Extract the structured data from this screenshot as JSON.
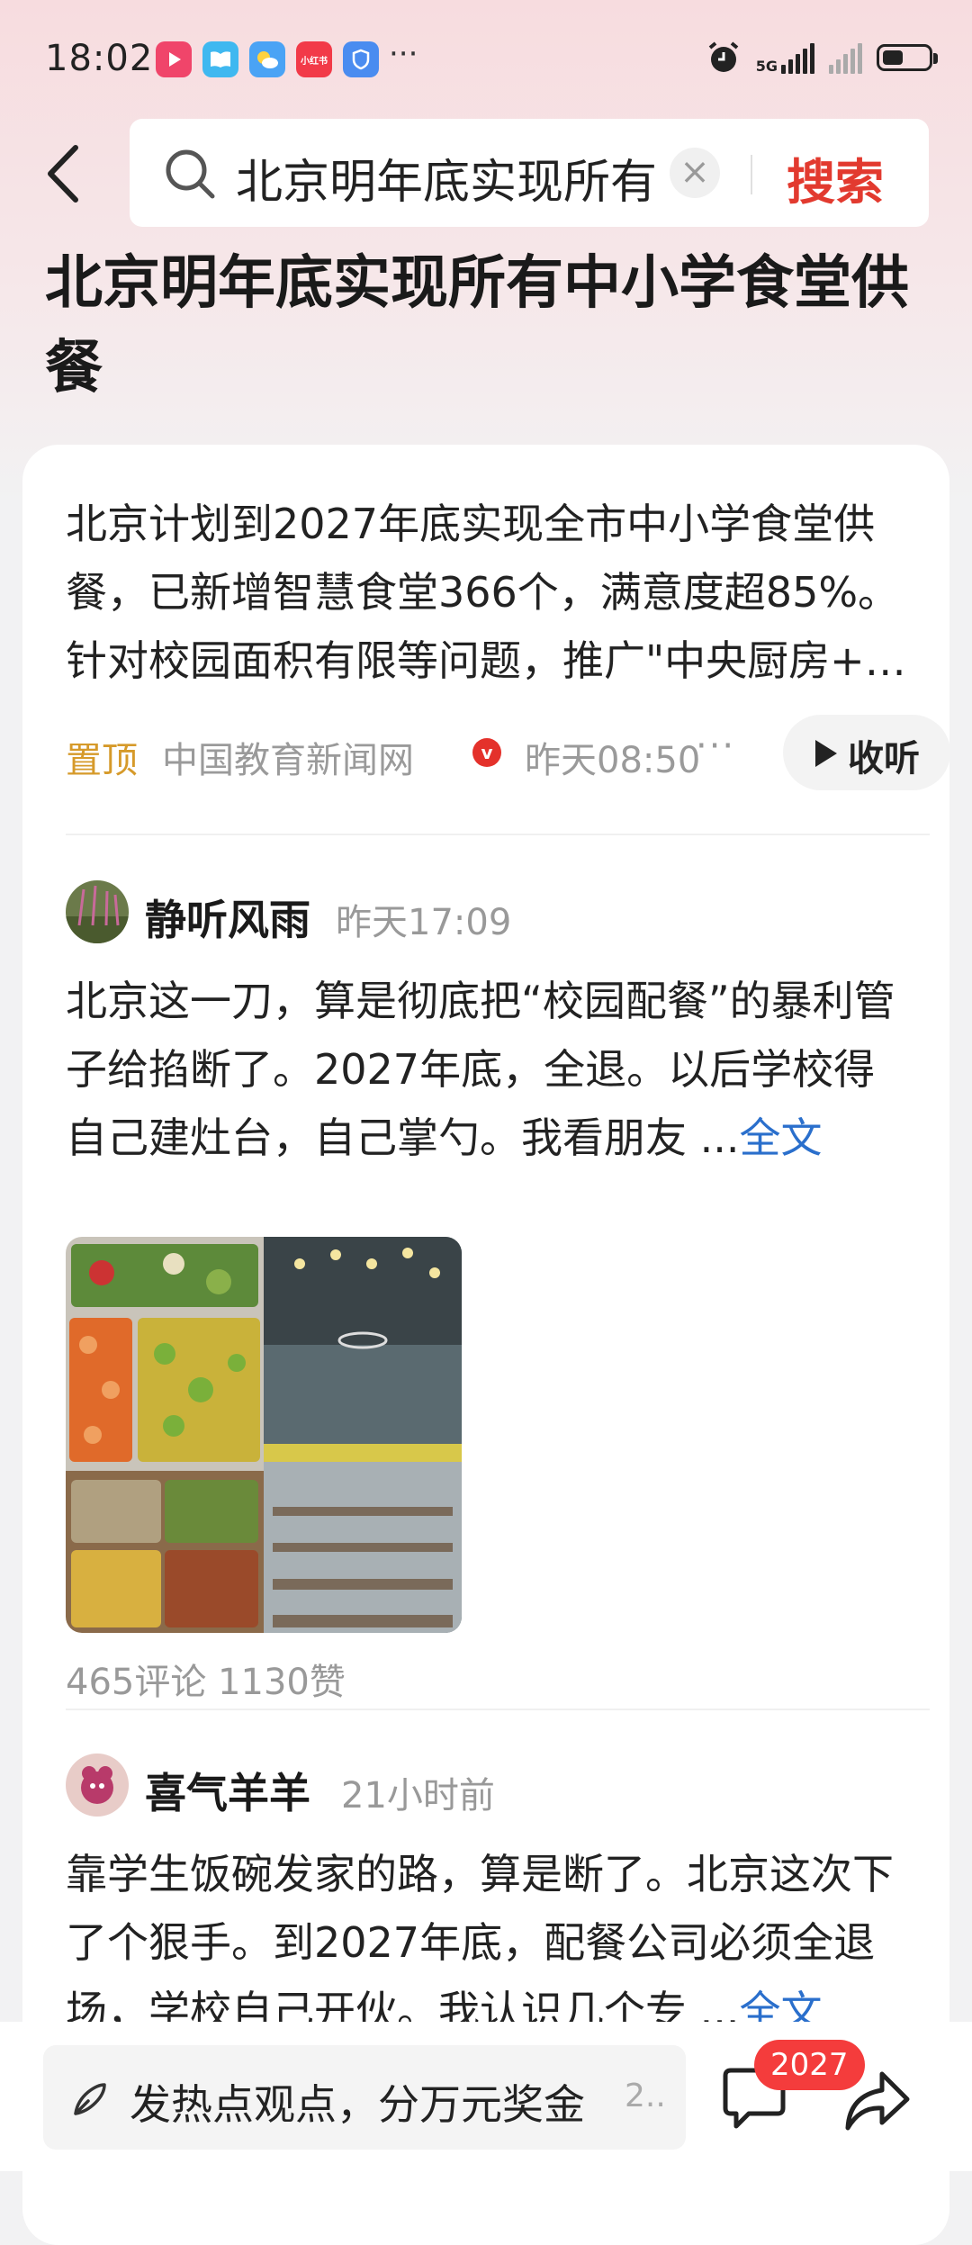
{
  "status_bar": {
    "time": "18:02",
    "app_icons": [
      "video-app-icon",
      "book-app-icon",
      "weather-app-icon",
      "xiaohongshu-icon",
      "shield-app-icon"
    ],
    "network_label": "5G",
    "battery_level": 0.4
  },
  "search": {
    "query": "北京明年底实现所有",
    "button_label": "搜索"
  },
  "page_title": "北京明年底实现所有中小学食堂供餐",
  "summary": {
    "text": "北京计划到2027年底实现全市中小学食堂供餐，已新增智慧食堂366个，满意度超85%。针对校园面积有限等问题，推广\"中央厨房+卫星厨房\"模式…",
    "pinned_label": "置顶",
    "source": "中国教育新闻网",
    "time": "昨天08:50",
    "listen_label": "收听"
  },
  "posts": [
    {
      "author": "静听风雨",
      "time": "昨天17:09",
      "body": "北京这一刀，算是彻底把“校园配餐”的暴利管子给掐断了。2027年底，全退。以后学校得自己建灶台，自己掌勺。我看朋友 ...",
      "full_label": "全文",
      "stats": "465评论  1130赞"
    },
    {
      "author": "喜气羊羊",
      "time": "21小时前",
      "body": "靠学生饭碗发家的路，算是断了。北京这次下了个狠手。到2027年底，配餐公司必须全退场，学校自己开伙。我认识几个专 ...",
      "full_label": "全文"
    }
  ],
  "bottom_bar": {
    "comment_placeholder": "发热点观点，分万元奖金",
    "comment_suffix": "2..",
    "comment_count": "2027"
  },
  "colors": {
    "accent_red": "#e23a2f",
    "pinned_gold": "#d69a2a",
    "link_blue": "#2a6fcc",
    "badge_red": "#f43c3c"
  }
}
